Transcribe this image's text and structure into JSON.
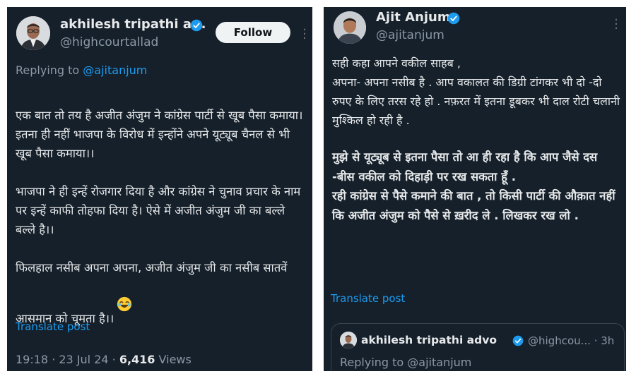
{
  "left_post": {
    "author": {
      "display_name": "akhilesh tripathi a...",
      "handle": "@highcourtallad",
      "avatar_icon": "profile-photo-man-glasses"
    },
    "follow_label": "Follow",
    "more_icon": "more-vertical-icon",
    "replying_prefix": "Replying to",
    "replying_handle": "@ajitanjum",
    "body": "एक बात तो तय है अजीत अंजुम ने कांग्रेस पार्टी से खूब पैसा कमाया। इतना ही नहीं भाजपा के विरोध में इन्होंने अपने यूट्यूब चैनल से भी खूब पैसा कमाया।।\n\nभाजपा ने ही इन्हें रोजगार दिया है और कांग्रेस ने चुनाव प्रचार के नाम पर इन्हें काफी तोहफा दिया है। ऐसे में अजीत अंजुम जी का बल्ले बल्ले है।।\n\nफिलहाल नसीब अपना अपना, अजीत अंजुम जी का नसीब सातवें आसमान को चूमता है।।",
    "emoji": "😂",
    "translate_label": "Translate post",
    "timestamp": "19:18 · 23 Jul 24 · ",
    "views_count": "6,416",
    "views_label": " Views"
  },
  "right_post": {
    "author": {
      "display_name": "Ajit Anjum",
      "handle": "@ajitanjum",
      "avatar_icon": "profile-photo-man"
    },
    "more_icon": "more-horizontal-icon",
    "body_plain": "सही कहा आपने वकील साहब ,\nअपना-  अपना नसीब है . आप वकालत की डिग्री टांगकर भी दो -दो रुपए के लिए तरस रहे हो . नफ़रत में इतना डूबकर भी दाल रोटी चलानी मुश्किल हो रही है .",
    "body_bold": "मुझे से यूट्यूब से इतना पैसा तो आ ही रहा है कि आप जैसे दस -बीस वकील को दिहाड़ी पर रख सकता हूँ .\nरही कांग्रेस से पैसे कमाने की बात , तो किसी पार्टी की औक़ात नहीं कि अजीत अंजुम को पैसे से ख़रीद ले . लिखकर रख लो .",
    "translate_label": "Translate post",
    "quoted": {
      "display_name": "akhilesh tripathi advo",
      "handle_time": "@highcou... · 3h",
      "replying": "Replying to @ajitanjum"
    }
  },
  "colors": {
    "panel_bg": "#15202b",
    "text_primary": "#e7e9ea",
    "text_secondary": "#8b98a5",
    "link_blue": "#1d9bf0",
    "verified_blue": "#1d9bf0",
    "follow_bg": "#eff3f4"
  }
}
